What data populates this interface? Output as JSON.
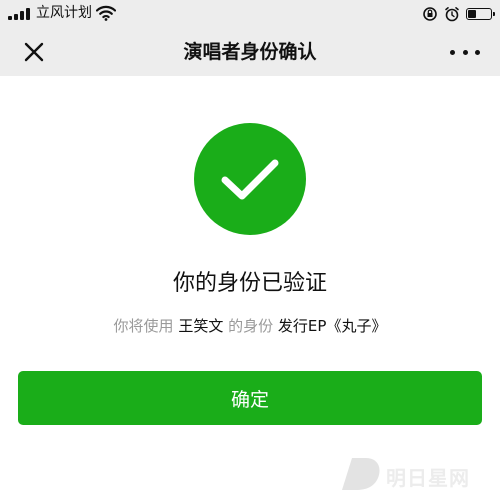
{
  "status_bar": {
    "carrier": "立风计划",
    "battery_level": 0.4
  },
  "nav": {
    "title": "演唱者身份确认"
  },
  "result": {
    "title": "你的身份已验证",
    "sub_prefix": "你将使用",
    "sub_name": "王笑文",
    "sub_middle": "的身份",
    "sub_action": "发行EP《丸子》"
  },
  "confirm_button": {
    "label": "确定"
  },
  "watermark": {
    "text": "明日星网"
  },
  "colors": {
    "accent_green": "#1aad19",
    "nav_background": "#ededed",
    "muted_text": "#9a9a9a"
  },
  "icons": {
    "close": "close-icon",
    "more": "more-icon",
    "success": "check-circle-icon",
    "wifi": "wifi-icon",
    "signal": "signal-icon",
    "battery": "battery-icon"
  }
}
